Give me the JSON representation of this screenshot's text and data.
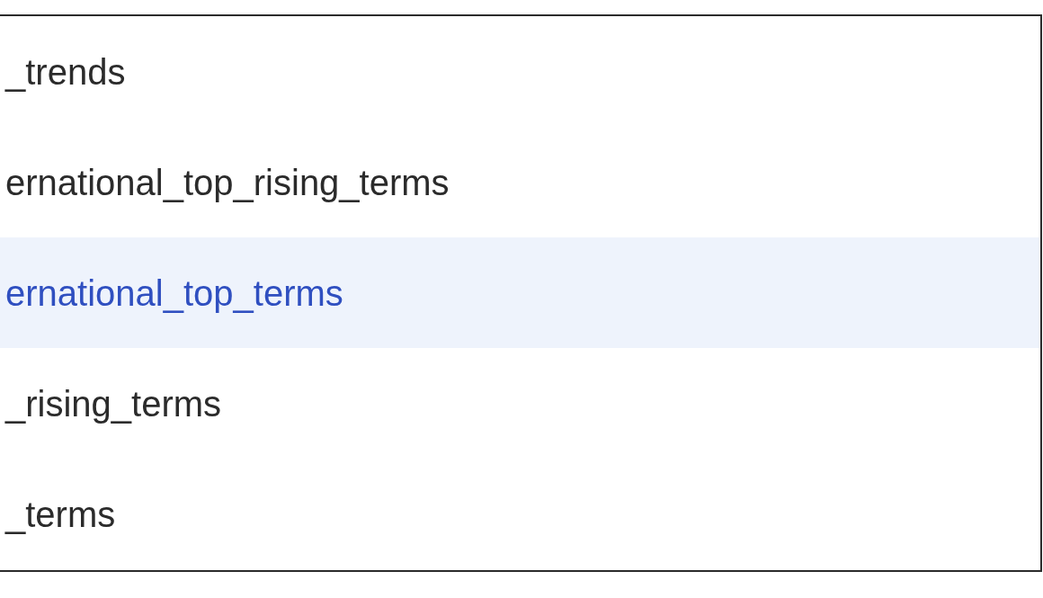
{
  "list": {
    "items": [
      {
        "label": "_trends",
        "selected": false
      },
      {
        "label": "ernational_top_rising_terms",
        "selected": false
      },
      {
        "label": "ernational_top_terms",
        "selected": true
      },
      {
        "label": "_rising_terms",
        "selected": false
      },
      {
        "label": "_terms",
        "selected": false
      }
    ]
  }
}
